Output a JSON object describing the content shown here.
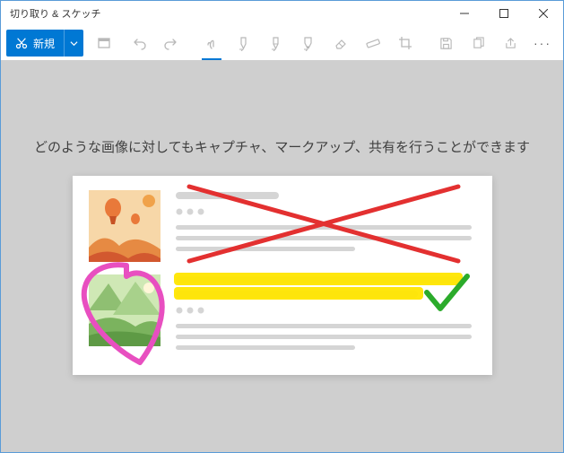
{
  "window": {
    "title": "切り取り & スケッチ"
  },
  "toolbar": {
    "new_label": "新規"
  },
  "hint": "どのような画像に対してもキャプチャ、マークアップ、共有を行うことができます",
  "icons": {
    "snip": "snip-icon",
    "new_dropdown": "chevron-down-icon",
    "delay": "delay-icon",
    "undo": "undo-icon",
    "redo": "redo-icon",
    "touch": "touch-write-icon",
    "ballpoint": "ballpoint-pen-icon",
    "pencil": "pencil-icon",
    "highlighter": "highlighter-icon",
    "eraser": "eraser-icon",
    "ruler": "ruler-icon",
    "crop": "crop-icon",
    "save": "save-icon",
    "copy": "copy-icon",
    "share": "share-icon",
    "more": "more-icon",
    "minimize": "minimize-icon",
    "maximize": "maximize-icon",
    "close": "close-icon"
  }
}
